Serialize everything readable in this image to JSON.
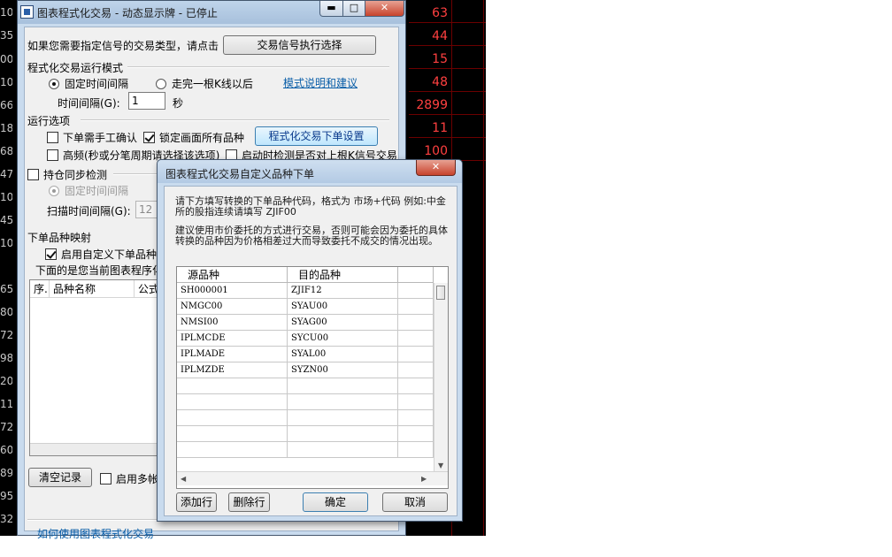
{
  "background_quotes": {
    "row_prefixes": [
      "10",
      "35",
      "00",
      "10",
      "66",
      "18",
      "68",
      "47",
      "10",
      "45",
      "10",
      "65",
      "80",
      "72",
      "98",
      "20",
      "11",
      "72",
      "60",
      "89",
      "95",
      "32"
    ],
    "values": [
      "63",
      "44",
      "15",
      "48",
      "2899",
      "11",
      "100"
    ]
  },
  "main_window": {
    "title": "图表程式化交易 - 动态显示牌 - 已停止",
    "signal_prompt": "如果您需要指定信号的交易类型，请点击",
    "signal_button": "交易信号执行选择",
    "mode_group": "程式化交易运行模式",
    "mode_fixed": "固定时间间隔",
    "mode_after_k": "走完一根K线以后",
    "mode_help_link": "模式说明和建议",
    "interval_label": "时间间隔(G):",
    "interval_value": "1",
    "interval_unit": "秒",
    "run_group": "运行选项",
    "manual_confirm": "下单需手工确认",
    "lock_all": "锁定画面所有品种",
    "order_settings_button": "程式化交易下单设置",
    "high_freq": "高频(秒或分笔周期请选择该选项)",
    "check_on_start": "启动时检测是否对上根K信号交易",
    "sync_check": "持仓同步检测",
    "sync_fixed": "固定时间间隔",
    "scan_interval_label": "扫描时间间隔(G):",
    "scan_interval_value": "12",
    "map_group": "下单品种映射",
    "enable_custom": "启用自定义下单品种",
    "map_desc": "下面的是您当前图表程序化",
    "col_seq": "序.",
    "col_name": "品种名称",
    "col_formula": "公式",
    "clear_button": "清空记录",
    "multi_account": "启用多帐",
    "howto_link": "如何使用图表程式化交易"
  },
  "dialog": {
    "title": "图表程式化交易自定义品种下单",
    "note1": "请下方填写转换的下单品种代码，格式为 市场+代码 例如:中金所的股指连续请填写 ZJIF00",
    "note2": "建议使用市价委托的方式进行交易，否则可能会因为委托的具体转换的品种因为价格相差过大而导致委托不成交的情况出现。",
    "col_source": "源品种",
    "col_target": "目的品种",
    "rows": [
      {
        "source": "SH000001",
        "target": "ZJIF12"
      },
      {
        "source": "NMGC00",
        "target": "SYAU00"
      },
      {
        "source": "NMSI00",
        "target": "SYAG00"
      },
      {
        "source": "IPLMCDE",
        "target": "SYCU00"
      },
      {
        "source": "IPLMADE",
        "target": "SYAL00"
      },
      {
        "source": "IPLMZDE",
        "target": "SYZN00"
      }
    ],
    "add_row": "添加行",
    "delete_row": "删除行",
    "ok": "确定",
    "cancel": "取消"
  }
}
